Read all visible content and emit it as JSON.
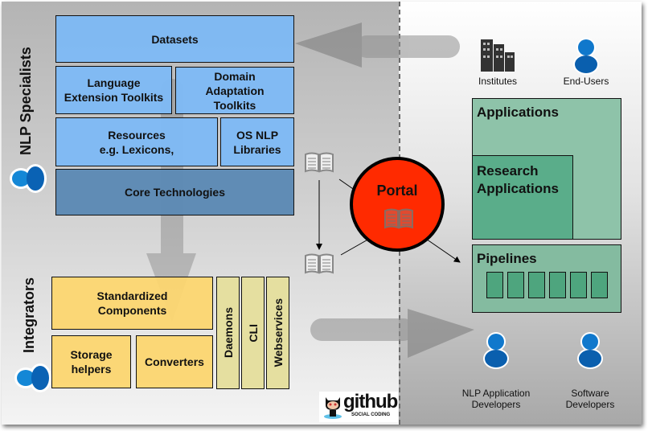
{
  "diagram": {
    "roles": {
      "nlp_specialists": "NLP Specialists",
      "integrators": "Integrators"
    },
    "specialist_stack": {
      "datasets": "Datasets",
      "language_extension_toolkits": [
        "Language",
        "Extension Toolkits"
      ],
      "domain_adaptation_toolkits": [
        "Domain",
        "Adaptation",
        "Toolkits"
      ],
      "resources": [
        "Resources",
        "e.g. Lexicons,"
      ],
      "os_nlp_libraries": [
        "OS NLP",
        "Libraries"
      ],
      "core_technologies": "Core Technologies"
    },
    "integrator_stack": {
      "standardized_components": [
        "Standardized",
        "Components"
      ],
      "storage_helpers": [
        "Storage",
        "helpers"
      ],
      "converters": "Converters",
      "daemons": "Daemons",
      "cli": "CLI",
      "webservices": "Webservices"
    },
    "portal": {
      "label": "Portal",
      "color": "#ff2a00"
    },
    "consumers": {
      "institutes": "Institutes",
      "end_users": "End-Users",
      "nlp_app_developers": [
        "NLP Application",
        "Developers"
      ],
      "software_developers": [
        "Software",
        "Developers"
      ]
    },
    "applications": {
      "applications": "Applications",
      "research_applications": [
        "Research",
        "Applications"
      ],
      "pipelines": "Pipelines",
      "pipeline_stage_count": 6
    },
    "logo": {
      "name": "github",
      "tagline": "SOCIAL CODING"
    },
    "colors": {
      "blue_box": "#7eb9f5",
      "core_box": "#5c89b4",
      "yellow_box": "#fcd670",
      "khaki_box": "#e5dfa0",
      "green_outer": "#8ec3a9",
      "green_inner": "#5aad8a",
      "user_icon": "#0d6fc0"
    }
  }
}
